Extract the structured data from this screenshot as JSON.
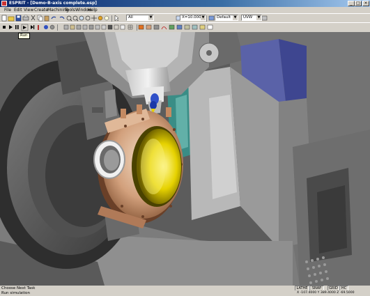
{
  "window": {
    "title": "ESPRIT - [Demo-B-axis complete.esp]"
  },
  "menu": [
    "File",
    "Edit",
    "View",
    "Create",
    "Machining",
    "Tools",
    "Window",
    "Help"
  ],
  "toolbar": {
    "layer_value": "All",
    "coord_value": "X=10.000 C",
    "style_value": "Default",
    "view_value": "UVW"
  },
  "tooltip": "Run",
  "status": {
    "prompt": "Choose Next Task",
    "message": "Run simulation",
    "panels": [
      "LATHE",
      "SNAP",
      "GRID",
      "HC"
    ],
    "coords": "X -107.4000  Y 389.4000  Z -69.5000"
  },
  "colors": {
    "titlebar": "#0a246a",
    "part_copper": "#d2a07c",
    "part_inner": "#e6d200",
    "machine_gray": "#8a8a8a",
    "glass_teal": "#3a8d86",
    "blue_panel": "#5a62a8"
  }
}
